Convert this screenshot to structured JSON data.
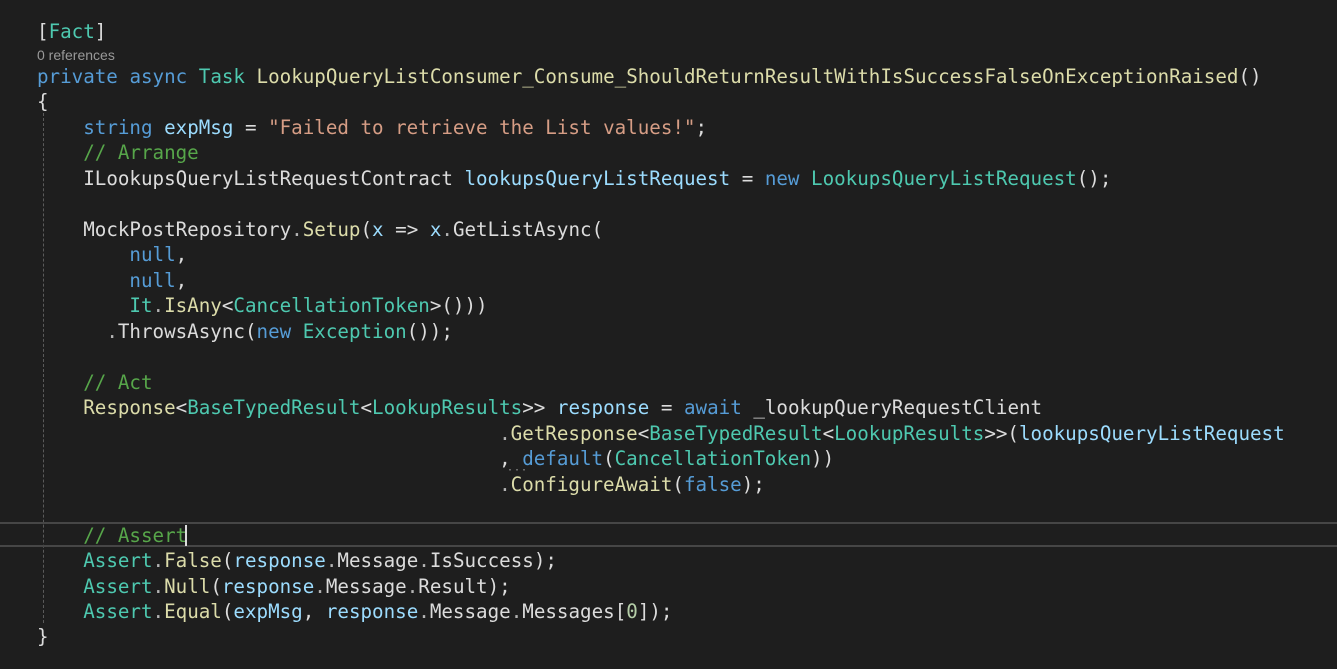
{
  "editor": {
    "codelens": "0 references",
    "lines": [
      [
        {
          "t": "[",
          "c": "pl"
        },
        {
          "t": "Fact",
          "c": "ty"
        },
        {
          "t": "]",
          "c": "pl"
        }
      ],
      [
        {
          "t": "private",
          "c": "kw"
        },
        {
          "t": " ",
          "c": "pl"
        },
        {
          "t": "async",
          "c": "kw"
        },
        {
          "t": " ",
          "c": "pl"
        },
        {
          "t": "Task",
          "c": "ty"
        },
        {
          "t": " ",
          "c": "pl"
        },
        {
          "t": "LookupQueryListConsumer_Consume_ShouldReturnResultWithIsSuccessFalseOnExceptionRaised",
          "c": "mt"
        },
        {
          "t": "()",
          "c": "pl"
        }
      ],
      [
        {
          "t": "{",
          "c": "pl"
        }
      ],
      [
        {
          "t": "    ",
          "c": "pl"
        },
        {
          "t": "string",
          "c": "kw"
        },
        {
          "t": " ",
          "c": "pl"
        },
        {
          "t": "expMsg",
          "c": "lc"
        },
        {
          "t": " = ",
          "c": "pl"
        },
        {
          "t": "\"Failed to retrieve the List values!\"",
          "c": "st"
        },
        {
          "t": ";",
          "c": "pl"
        }
      ],
      [
        {
          "t": "    ",
          "c": "pl"
        },
        {
          "t": "// Arrange",
          "c": "cm"
        }
      ],
      [
        {
          "t": "    ",
          "c": "pl"
        },
        {
          "t": "ILookupsQueryListRequestContract",
          "c": "pl"
        },
        {
          "t": " ",
          "c": "pl"
        },
        {
          "t": "lookupsQueryListRequest",
          "c": "lc"
        },
        {
          "t": " = ",
          "c": "pl"
        },
        {
          "t": "new",
          "c": "kw"
        },
        {
          "t": " ",
          "c": "pl"
        },
        {
          "t": "LookupsQueryListRequest",
          "c": "ty"
        },
        {
          "t": "();",
          "c": "pl"
        }
      ],
      [],
      [
        {
          "t": "    ",
          "c": "pl"
        },
        {
          "t": "MockPostRepository",
          "c": "pl"
        },
        {
          "t": ".",
          "c": "op"
        },
        {
          "t": "Setup",
          "c": "mt"
        },
        {
          "t": "(",
          "c": "pl"
        },
        {
          "t": "x",
          "c": "pm"
        },
        {
          "t": " => ",
          "c": "pl"
        },
        {
          "t": "x",
          "c": "pm"
        },
        {
          "t": ".",
          "c": "op"
        },
        {
          "t": "GetListAsync",
          "c": "pl"
        },
        {
          "t": "(",
          "c": "pl"
        }
      ],
      [
        {
          "t": "        ",
          "c": "pl"
        },
        {
          "t": "null",
          "c": "kw"
        },
        {
          "t": ",",
          "c": "pl"
        }
      ],
      [
        {
          "t": "        ",
          "c": "pl"
        },
        {
          "t": "null",
          "c": "kw"
        },
        {
          "t": ",",
          "c": "pl"
        }
      ],
      [
        {
          "t": "        ",
          "c": "pl"
        },
        {
          "t": "It",
          "c": "ty"
        },
        {
          "t": ".",
          "c": "op"
        },
        {
          "t": "IsAny",
          "c": "mt"
        },
        {
          "t": "<",
          "c": "pl"
        },
        {
          "t": "CancellationToken",
          "c": "ty"
        },
        {
          "t": ">()))",
          "c": "pl"
        }
      ],
      [
        {
          "t": "      ",
          "c": "pl"
        },
        {
          "t": ".",
          "c": "op"
        },
        {
          "t": "ThrowsAsync",
          "c": "pl"
        },
        {
          "t": "(",
          "c": "pl"
        },
        {
          "t": "new",
          "c": "kw"
        },
        {
          "t": " ",
          "c": "pl"
        },
        {
          "t": "Exception",
          "c": "ty"
        },
        {
          "t": "());",
          "c": "pl"
        }
      ],
      [],
      [
        {
          "t": "    ",
          "c": "pl"
        },
        {
          "t": "// Act",
          "c": "cm"
        }
      ],
      [
        {
          "t": "    ",
          "c": "pl"
        },
        {
          "t": "Response",
          "c": "mt"
        },
        {
          "t": "<",
          "c": "pl"
        },
        {
          "t": "BaseTypedResult",
          "c": "ty"
        },
        {
          "t": "<",
          "c": "pl"
        },
        {
          "t": "LookupResults",
          "c": "ty"
        },
        {
          "t": ">>",
          "c": "pl"
        },
        {
          "t": " ",
          "c": "pl"
        },
        {
          "t": "response",
          "c": "lc"
        },
        {
          "t": " = ",
          "c": "pl"
        },
        {
          "t": "await",
          "c": "kw"
        },
        {
          "t": " ",
          "c": "pl"
        },
        {
          "t": "_lookupQueryRequestClient",
          "c": "pl"
        }
      ],
      [
        {
          "t": "                                        ",
          "c": "pl"
        },
        {
          "t": ".",
          "c": "op"
        },
        {
          "t": "GetResponse",
          "c": "mt"
        },
        {
          "t": "<",
          "c": "pl"
        },
        {
          "t": "BaseTypedResult",
          "c": "ty"
        },
        {
          "t": "<",
          "c": "pl"
        },
        {
          "t": "LookupResults",
          "c": "ty"
        },
        {
          "t": ">>(",
          "c": "pl"
        },
        {
          "t": "lookupsQueryListRequest",
          "c": "lc"
        }
      ],
      [
        {
          "t": "                                        ",
          "c": "pl"
        },
        {
          "t": ", ",
          "c": "pl"
        },
        {
          "t": "default",
          "c": "kw"
        },
        {
          "t": "(",
          "c": "pl"
        },
        {
          "t": "CancellationToken",
          "c": "ty"
        },
        {
          "t": "))",
          "c": "pl"
        }
      ],
      [
        {
          "t": "                                        ",
          "c": "pl"
        },
        {
          "t": ".",
          "c": "op"
        },
        {
          "t": "ConfigureAwait",
          "c": "mt"
        },
        {
          "t": "(",
          "c": "pl"
        },
        {
          "t": "false",
          "c": "kw"
        },
        {
          "t": ");",
          "c": "pl"
        }
      ],
      [],
      [
        {
          "t": "    ",
          "c": "pl"
        },
        {
          "t": "// Assert",
          "c": "cm"
        }
      ],
      [
        {
          "t": "    ",
          "c": "pl"
        },
        {
          "t": "Assert",
          "c": "ty"
        },
        {
          "t": ".",
          "c": "op"
        },
        {
          "t": "False",
          "c": "mt"
        },
        {
          "t": "(",
          "c": "pl"
        },
        {
          "t": "response",
          "c": "lc"
        },
        {
          "t": ".",
          "c": "op"
        },
        {
          "t": "Message",
          "c": "pl"
        },
        {
          "t": ".",
          "c": "op"
        },
        {
          "t": "IsSuccess",
          "c": "pl"
        },
        {
          "t": ");",
          "c": "pl"
        }
      ],
      [
        {
          "t": "    ",
          "c": "pl"
        },
        {
          "t": "Assert",
          "c": "ty"
        },
        {
          "t": ".",
          "c": "op"
        },
        {
          "t": "Null",
          "c": "mt"
        },
        {
          "t": "(",
          "c": "pl"
        },
        {
          "t": "response",
          "c": "lc"
        },
        {
          "t": ".",
          "c": "op"
        },
        {
          "t": "Message",
          "c": "pl"
        },
        {
          "t": ".",
          "c": "op"
        },
        {
          "t": "Result",
          "c": "pl"
        },
        {
          "t": ");",
          "c": "pl"
        }
      ],
      [
        {
          "t": "    ",
          "c": "pl"
        },
        {
          "t": "Assert",
          "c": "ty"
        },
        {
          "t": ".",
          "c": "op"
        },
        {
          "t": "Equal",
          "c": "mt"
        },
        {
          "t": "(",
          "c": "pl"
        },
        {
          "t": "expMsg",
          "c": "lc"
        },
        {
          "t": ", ",
          "c": "pl"
        },
        {
          "t": "response",
          "c": "lc"
        },
        {
          "t": ".",
          "c": "op"
        },
        {
          "t": "Message",
          "c": "pl"
        },
        {
          "t": ".",
          "c": "op"
        },
        {
          "t": "Messages",
          "c": "pl"
        },
        {
          "t": "[",
          "c": "pl"
        },
        {
          "t": "0",
          "c": "nm"
        },
        {
          "t": "]);",
          "c": "pl"
        }
      ],
      [
        {
          "t": "}",
          "c": "pl"
        }
      ]
    ]
  },
  "colors": {
    "background": "#1e1e1e",
    "keyword": "#569cd6",
    "type": "#4ec9b0",
    "comment": "#57a64a",
    "string": "#d69d85",
    "method": "#dcdcaa",
    "local": "#9cdcfe",
    "number": "#b5cea8",
    "plain": "#dcdcdc"
  }
}
